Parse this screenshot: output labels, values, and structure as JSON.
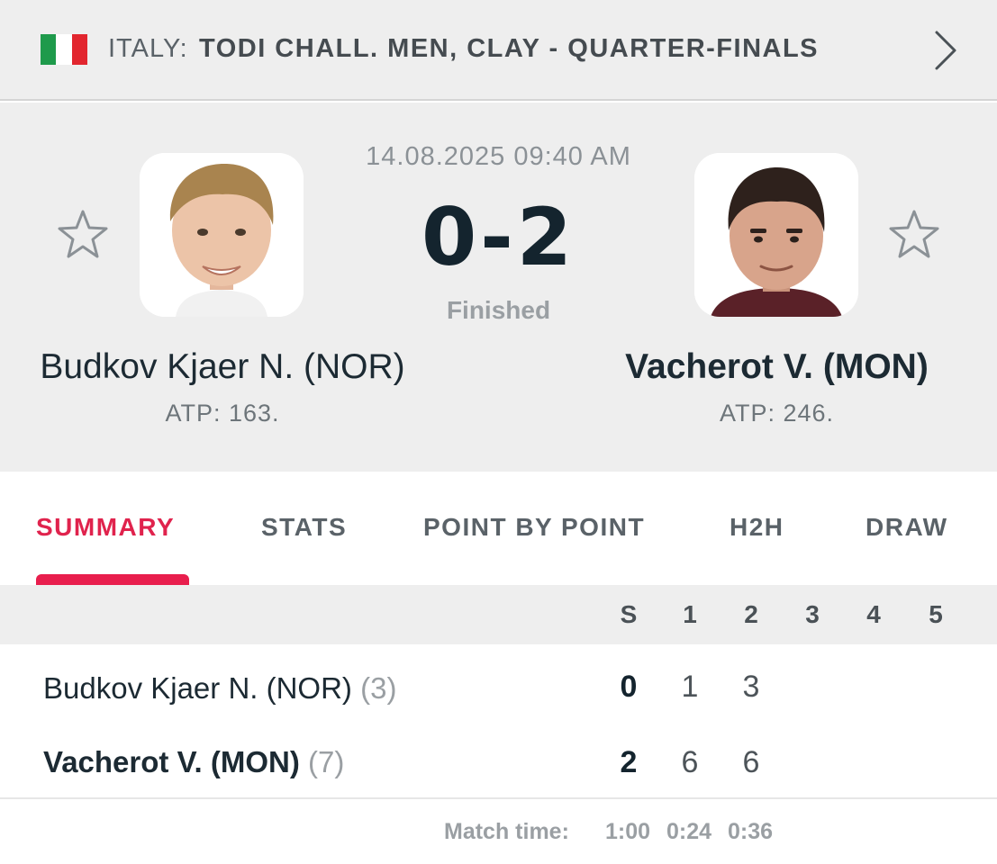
{
  "header": {
    "country": "ITALY:",
    "tournament": "TODI CHALL. MEN, CLAY - QUARTER-FINALS",
    "flag_colors": [
      "#1e9a4b",
      "#ffffff",
      "#e2262f"
    ]
  },
  "match": {
    "datetime": "14.08.2025 09:40 AM",
    "score": "0-2",
    "status": "Finished"
  },
  "players": [
    {
      "name": "Budkov Kjaer N. (NOR)",
      "rank": "ATP: 163.",
      "winner": false
    },
    {
      "name": "Vacherot V. (MON)",
      "rank": "ATP: 246.",
      "winner": true
    }
  ],
  "tabs": [
    {
      "label": "SUMMARY",
      "active": true
    },
    {
      "label": "STATS",
      "active": false
    },
    {
      "label": "POINT BY POINT",
      "active": false
    },
    {
      "label": "H2H",
      "active": false
    },
    {
      "label": "DRAW",
      "active": false
    }
  ],
  "score_table": {
    "columns": [
      "S",
      "1",
      "2",
      "3",
      "4",
      "5"
    ],
    "rows": [
      {
        "name": "Budkov Kjaer N. (NOR)",
        "seed": "(3)",
        "sets": "0",
        "games": [
          "1",
          "3"
        ]
      },
      {
        "name": "Vacherot V. (MON)",
        "seed": "(7)",
        "sets": "2",
        "games": [
          "6",
          "6"
        ]
      }
    ],
    "match_time_label": "Match time:",
    "match_time_values": [
      "1:00",
      "0:24",
      "0:36"
    ]
  },
  "colors": {
    "accent": "#e81e4d",
    "score": "#14242e"
  }
}
